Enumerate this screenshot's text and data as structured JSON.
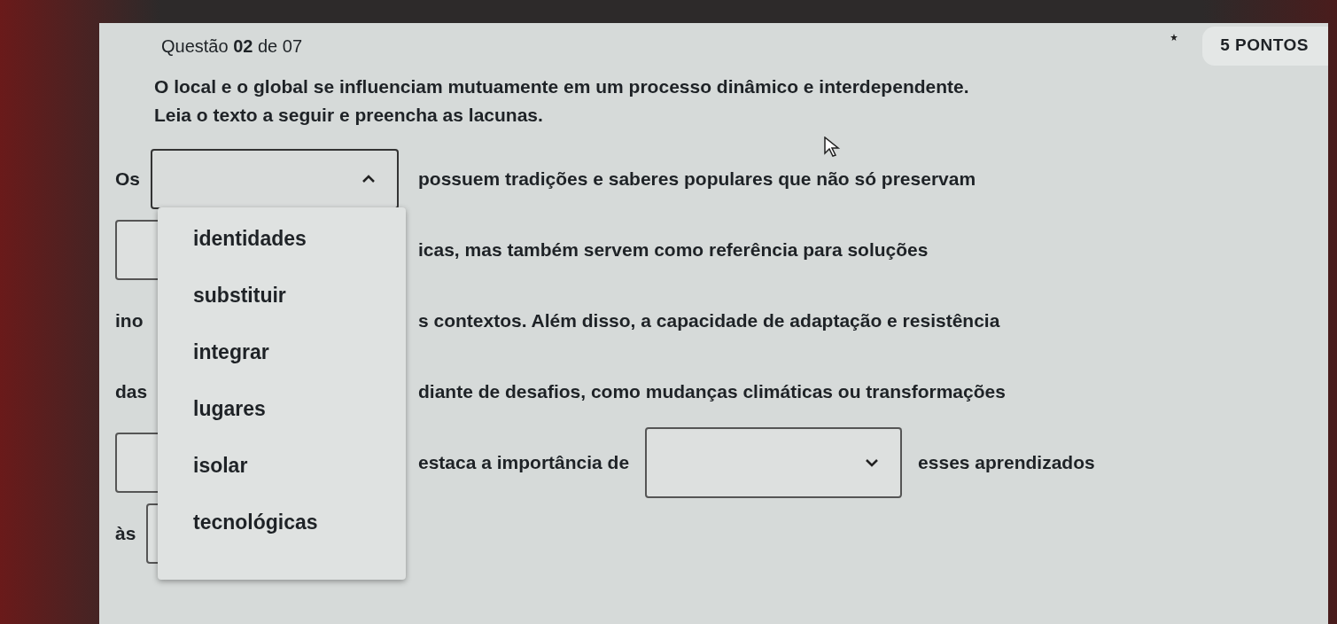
{
  "header": {
    "question": "Questão **02** de 07",
    "points": "5 PONTOS"
  },
  "prompt": [
    "O local e o global se influenciam mutuamente em um processo dinâmico e interdependente.",
    "Leia o texto a seguir e preencha as lacunas."
  ],
  "lines": [
    {
      "left": [
        {
          "kind": "text",
          "text": "Os"
        },
        {
          "kind": "blank",
          "expanded": true
        }
      ],
      "right": [
        {
          "kind": "text",
          "text": "possuem tradições e saberes populares que não só preservam"
        }
      ]
    },
    {
      "left": [
        {
          "kind": "hidden_blank"
        }
      ],
      "right": [
        {
          "kind": "text",
          "text": "icas, mas também servem como referência para soluções"
        }
      ]
    },
    {
      "left": [
        {
          "kind": "text",
          "text": "ino"
        }
      ],
      "right": [
        {
          "kind": "text",
          "text": "s contextos. Além disso, a capacidade de adaptação e resistência"
        }
      ]
    },
    {
      "left": [
        {
          "kind": "text",
          "text": "das"
        }
      ],
      "right": [
        {
          "kind": "text",
          "text": "diante de desafios, como mudanças climáticas ou transformações"
        }
      ]
    },
    {
      "left": [
        {
          "kind": "hidden_blank"
        }
      ],
      "right": [
        {
          "kind": "text",
          "text": "estaca a importância de"
        },
        {
          "kind": "blank",
          "expanded": false
        },
        {
          "kind": "text",
          "text": "esses aprendizados"
        }
      ]
    },
    {
      "left": [
        {
          "kind": "text",
          "text": "às"
        },
        {
          "kind": "hidden_blank"
        }
      ]
    }
  ],
  "menu": {
    "items": [
      {
        "label": "identidades"
      },
      {
        "label": "substituir"
      },
      {
        "label": "integrar"
      },
      {
        "label": "lugares"
      },
      {
        "label": "isolar"
      },
      {
        "label": "tecnológicas"
      }
    ]
  }
}
